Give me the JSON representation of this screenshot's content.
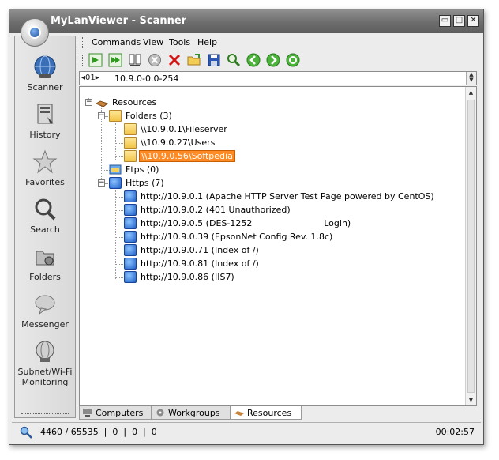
{
  "window": {
    "title": "MyLanViewer - Scanner"
  },
  "title_buttons": {
    "minimize": "▭",
    "maximize": "□",
    "close": "✕"
  },
  "sidebar": {
    "items": [
      {
        "label": "Scanner",
        "icon": "globe-network-icon"
      },
      {
        "label": "History",
        "icon": "history-icon"
      },
      {
        "label": "Favorites",
        "icon": "star-icon"
      },
      {
        "label": "Search",
        "icon": "magnifier-icon"
      },
      {
        "label": "Folders",
        "icon": "shared-folder-icon"
      },
      {
        "label": "Messenger",
        "icon": "speech-bubble-icon"
      },
      {
        "label": "Subnet/Wi-Fi",
        "label2": "Monitoring",
        "icon": "monitor-globe-icon"
      }
    ]
  },
  "menu": {
    "items": [
      "Commands",
      "View",
      "Tools",
      "Help"
    ]
  },
  "toolbar": {
    "buttons": [
      "scan-icon",
      "quick-scan-icon",
      "scan-list-icon",
      "stop-icon",
      "delete-icon",
      "open-icon",
      "save-icon",
      "find-icon",
      "back-icon",
      "forward-icon",
      "refresh-icon"
    ]
  },
  "address": {
    "prefix": "◂01▸",
    "value": "10.9.0-0.0-254"
  },
  "tree": {
    "root": "Resources",
    "folders_label": "Folders (3)",
    "folders": [
      "\\\\10.9.0.1\\Fileserver",
      "\\\\10.9.0.27\\Users",
      "\\\\10.9.0.56\\Softpedia"
    ],
    "selected_folder_index": 2,
    "ftps_label": "Ftps (0)",
    "https_label": "Https (7)",
    "https": [
      "http://10.9.0.1 (Apache HTTP Server Test Page powered by CentOS)",
      "http://10.9.0.2 (401 Unauthorized)",
      "http://10.9.0.5 (DES-1252                          Login)",
      "http://10.9.0.39 (EpsonNet Config Rev. 1.8c)",
      "http://10.9.0.71 (Index of /)",
      "http://10.9.0.81 (Index of /)",
      "http://10.9.0.86 (IIS7)"
    ]
  },
  "tabs": [
    {
      "label": "Computers",
      "active": false
    },
    {
      "label": "Workgroups",
      "active": false
    },
    {
      "label": "Resources",
      "active": true
    }
  ],
  "status": {
    "text": "4460 / 65535  |  0  |  0  |  0",
    "time": "00:02:57"
  },
  "colors": {
    "selection": "#ff8a24",
    "titlebar": "#6d6d6d"
  }
}
